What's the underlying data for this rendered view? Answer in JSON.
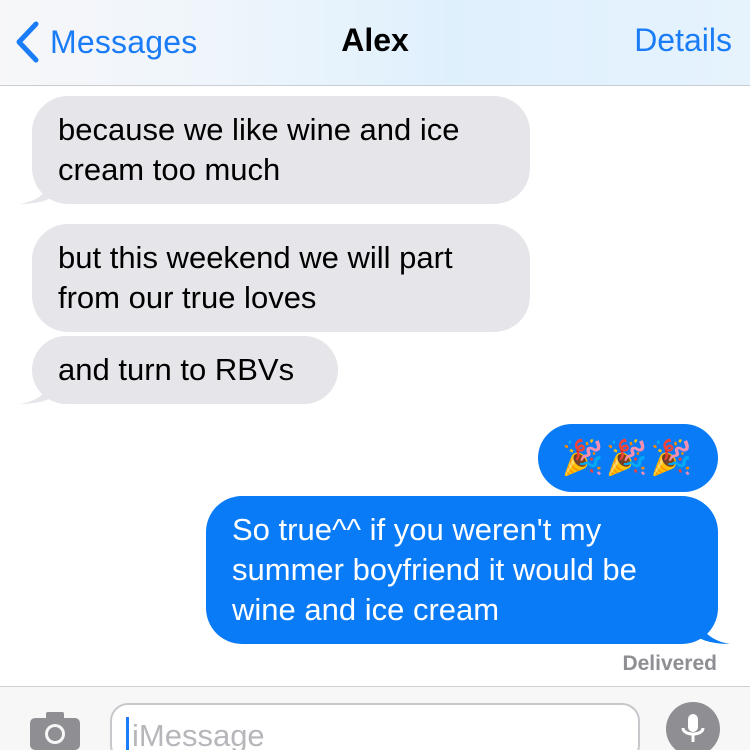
{
  "nav": {
    "back_label": "Messages",
    "title": "Alex",
    "details_label": "Details"
  },
  "messages": [
    {
      "direction": "incoming",
      "text": "because we like wine and ice\ncream too much"
    },
    {
      "direction": "incoming",
      "text": "but this weekend we will part\nfrom our true loves"
    },
    {
      "direction": "incoming",
      "text": "and turn to RBVs"
    },
    {
      "direction": "outgoing",
      "text": "🎉🎉🎉",
      "emoji": "party-popper"
    },
    {
      "direction": "outgoing",
      "text": "So true^^ if you weren't my\nsummer boyfriend it would be\nwine and ice cream"
    }
  ],
  "status": {
    "delivered": "Delivered"
  },
  "composer": {
    "placeholder": "iMessage"
  },
  "colors": {
    "accent": "#1a7cf6",
    "incoming_bubble": "#e5e5ea",
    "outgoing_bubble": "#0a7bf6"
  },
  "icons": [
    "chevron-left-icon",
    "camera-icon",
    "microphone-icon",
    "party-popper-icon"
  ]
}
